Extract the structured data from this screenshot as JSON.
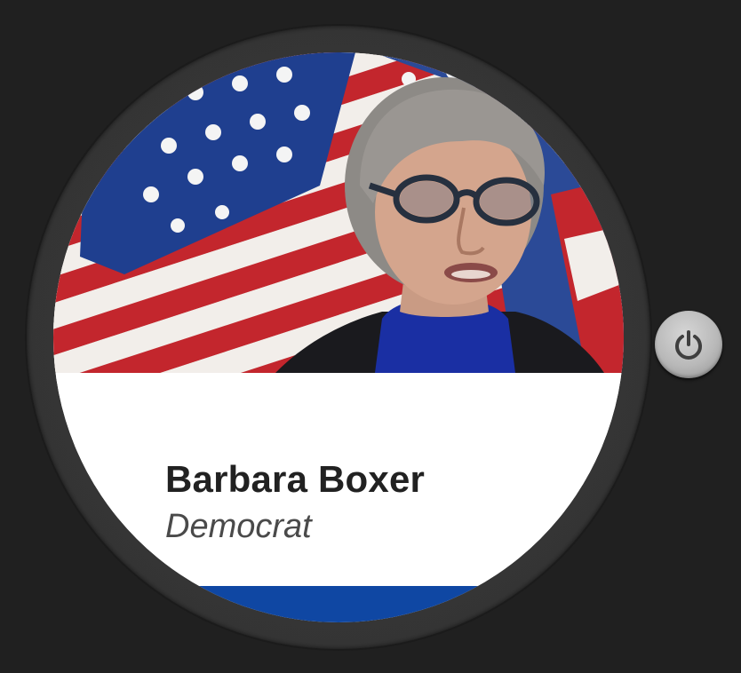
{
  "senator": {
    "name": "Barbara Boxer",
    "party": "Democrat"
  },
  "colors": {
    "background": "#202020",
    "bezel": "#333333",
    "card": "#ffffff",
    "name_text": "#212121",
    "party_text": "#4a4a4a",
    "party_bar": "#0f47a3",
    "power_button": "#bdbdbd"
  },
  "icons": {
    "power": "power-icon"
  }
}
